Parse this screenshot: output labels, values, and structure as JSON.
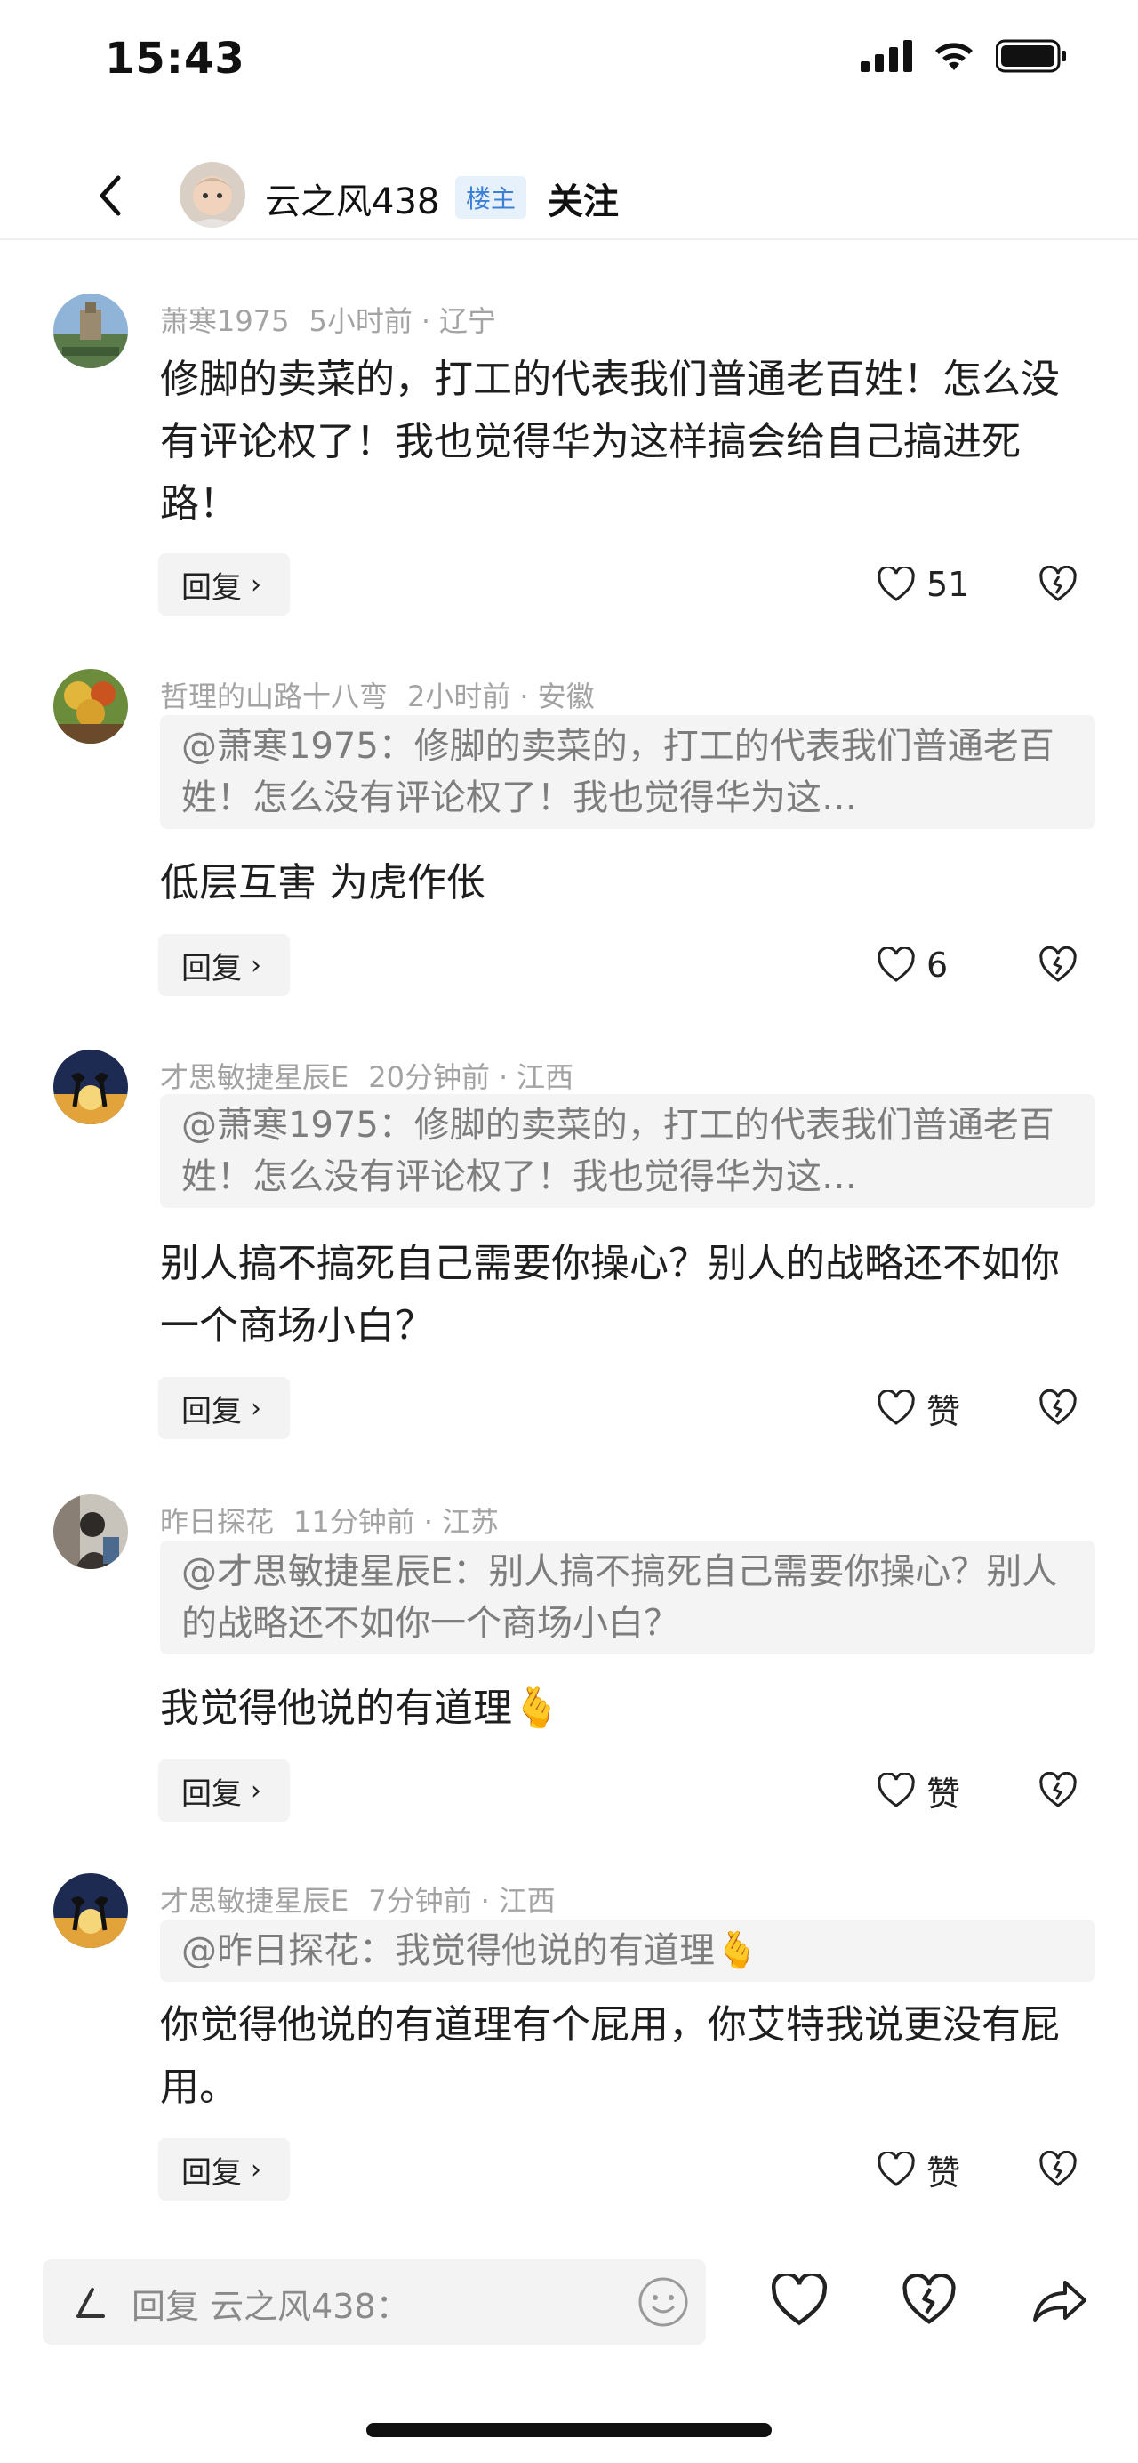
{
  "status_bar": {
    "time": "15:43"
  },
  "header": {
    "name": "云之风438",
    "badge": "楼主",
    "follow": "关注"
  },
  "comments": [
    {
      "user": "萧寒1975",
      "time": "5小时前",
      "location": "辽宁",
      "quote": "",
      "text": "修脚的卖菜的，打工的代表我们普通老百姓！怎么没有评论权了！我也觉得华为这样搞会给自己搞进死路！",
      "reply": "回复",
      "likes": "51"
    },
    {
      "user": "哲理的山路十八弯",
      "time": "2小时前",
      "location": "安徽",
      "quote": "@萧寒1975：修脚的卖菜的，打工的代表我们普通老百姓！怎么没有评论权了！我也觉得华为这…",
      "text": "低层互害 为虎作伥",
      "reply": "回复",
      "likes": "6"
    },
    {
      "user": "才思敏捷星辰E",
      "time": "20分钟前",
      "location": "江西",
      "quote": "@萧寒1975：修脚的卖菜的，打工的代表我们普通老百姓！怎么没有评论权了！我也觉得华为这…",
      "text": "别人搞不搞死自己需要你操心？别人的战略还不如你一个商场小白？",
      "reply": "回复",
      "likes": "赞"
    },
    {
      "user": "昨日探花",
      "time": "11分钟前",
      "location": "江苏",
      "quote": "@才思敏捷星辰E：别人搞不搞死自己需要你操心？别人的战略还不如你一个商场小白？",
      "text": "我觉得他说的有道理🫰",
      "reply": "回复",
      "likes": "赞"
    },
    {
      "user": "才思敏捷星辰E",
      "time": "7分钟前",
      "location": "江西",
      "quote": "@昨日探花：我觉得他说的有道理🫰",
      "text": "你觉得他说的有道理有个屁用，你艾特我说更没有屁用。",
      "reply": "回复",
      "likes": "赞"
    }
  ],
  "bottom_bar": {
    "placeholder": "回复 云之风438："
  }
}
